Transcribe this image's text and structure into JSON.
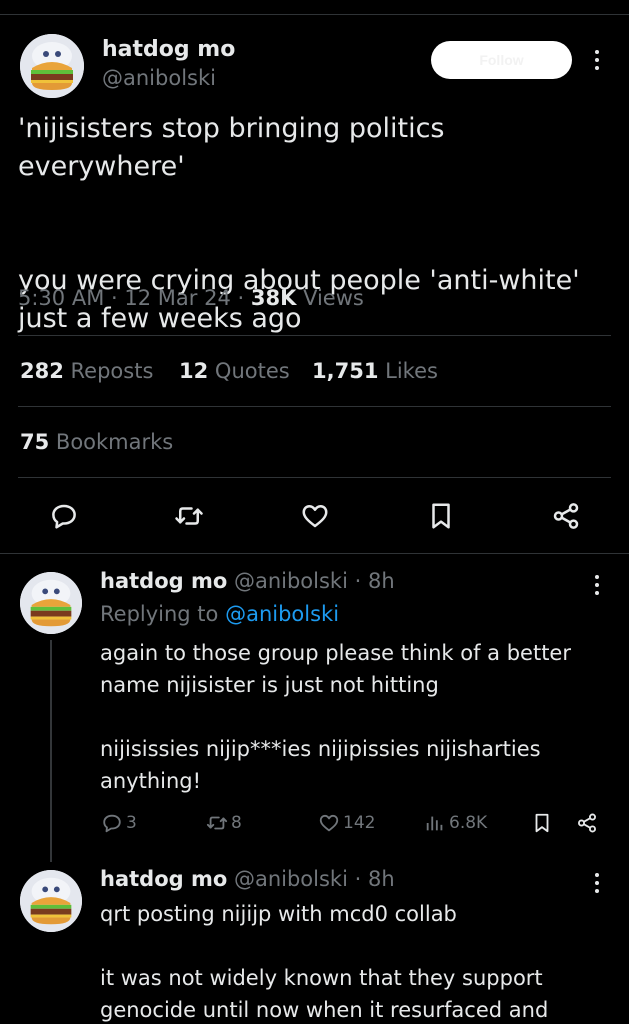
{
  "main_tweet": {
    "author_name": "hatdog mo",
    "author_handle": "@anibolski",
    "follow_label": "Follow",
    "text": "'nijisisters stop bringing politics everywhere'\n\n\nyou were crying about people 'anti-white'\njust a few weeks ago",
    "time": "5:30 AM",
    "date": "12 Mar 24",
    "views_count": "38K",
    "views_label": "Views",
    "reposts_count": "282",
    "reposts_label": "Reposts",
    "quotes_count": "12",
    "quotes_label": "Quotes",
    "likes_count": "1,751",
    "likes_label": "Likes",
    "bookmarks_count": "75",
    "bookmarks_label": "Bookmarks"
  },
  "reply_1": {
    "author_name": "hatdog mo",
    "author_handle": "@anibolski",
    "time_ago": "8h",
    "replying_prefix": "Replying to",
    "replying_to": "@anibolski",
    "text": "again to those group please think of a better\nname nijisister is just not hitting\n\nnijisissies nijip***ies nijipissies nijisharties\nanything!",
    "replies": "3",
    "reposts": "8",
    "likes": "142",
    "views": "6.8K"
  },
  "reply_2": {
    "author_name": "hatdog mo",
    "author_handle": "@anibolski",
    "time_ago": "8h",
    "text": "qrt posting nijijp with mcd0 collab\n\nit was not widely known that they support\ngenocide until now when it resurfaced and"
  },
  "sep": "·",
  "colors": {
    "background": "#000000",
    "text": "#e7e9ea",
    "muted": "#71767b",
    "link": "#1d9bf0",
    "divider": "#2f3336"
  },
  "icons": [
    "more-icon",
    "reply-icon",
    "repost-icon",
    "like-icon",
    "bookmark-icon",
    "share-icon",
    "views-icon"
  ]
}
